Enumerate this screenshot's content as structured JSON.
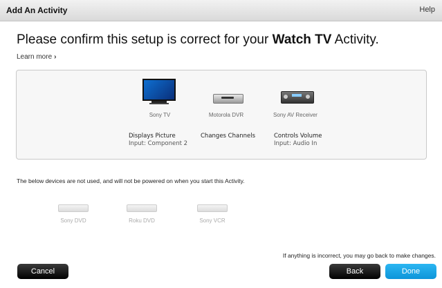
{
  "window": {
    "title": "Add An Activity",
    "help": "Help"
  },
  "heading": {
    "prefix": "Please confirm this setup is correct for your ",
    "activity": "Watch TV",
    "suffix": " Activity."
  },
  "learn_more": "Learn more",
  "learn_more_icon": "chevron-right-icon",
  "devices": [
    {
      "name": "Sony TV",
      "icon": "tv-icon"
    },
    {
      "name": "Motorola DVR",
      "icon": "dvr-icon"
    },
    {
      "name": "Sony AV Receiver",
      "icon": "av-receiver-icon"
    }
  ],
  "roles": [
    {
      "title": "Displays Picture",
      "detail": "Input: Component 2"
    },
    {
      "title": "Changes Channels",
      "detail": ""
    },
    {
      "title": "Controls Volume",
      "detail": "Input: Audio In"
    }
  ],
  "unused_text": "The below devices are not used, and will not be powered on when you start this Activity.",
  "unused_devices": [
    {
      "name": "Sony DVD",
      "icon": "dvd-player-icon"
    },
    {
      "name": "Roku DVD",
      "icon": "dvd-player-icon"
    },
    {
      "name": "Sony VCR",
      "icon": "vcr-icon"
    }
  ],
  "incorrect_text": "If anything is incorrect, you may go back to make changes.",
  "buttons": {
    "cancel": "Cancel",
    "back": "Back",
    "done": "Done"
  },
  "colors": {
    "done_button": "#1aa6e8",
    "dark_button": "#111111",
    "tv_screen": "#0e6fd1"
  }
}
